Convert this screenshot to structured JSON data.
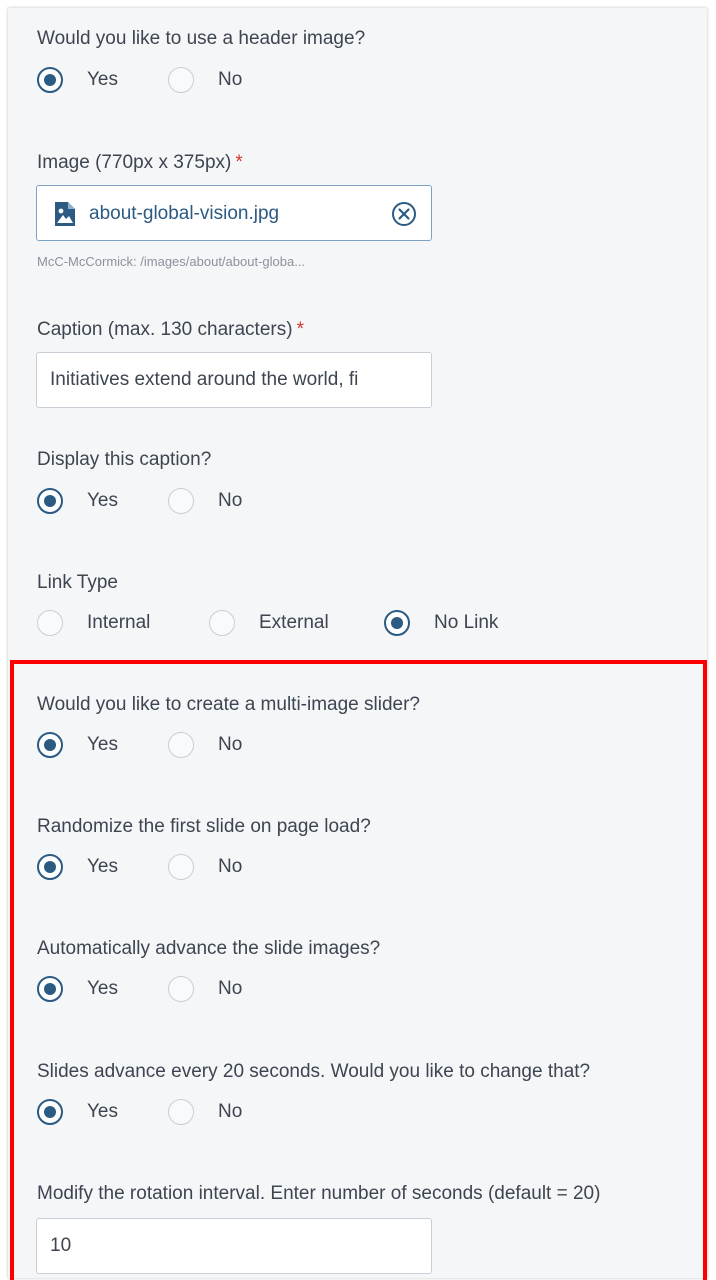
{
  "header_image": {
    "question": "Would you like to use a header image?",
    "options": [
      {
        "label": "Yes",
        "checked": true
      },
      {
        "label": "No",
        "checked": false
      }
    ]
  },
  "image": {
    "label": "Image (770px x 375px)",
    "required_mark": "*",
    "file_name": "about-global-vision.jpg",
    "file_icon": "image-file-icon",
    "remove_icon": "circle-x-icon",
    "path_hint": "McC-McCormick: /images/about/about-globa..."
  },
  "caption": {
    "label": "Caption (max. 130 characters)",
    "required_mark": "*",
    "value": "Initiatives extend around the world, fi"
  },
  "display_caption": {
    "question": "Display this caption?",
    "options": [
      {
        "label": "Yes",
        "checked": true
      },
      {
        "label": "No",
        "checked": false
      }
    ]
  },
  "link_type": {
    "question": "Link Type",
    "options": [
      {
        "label": "Internal",
        "checked": false
      },
      {
        "label": "External",
        "checked": false
      },
      {
        "label": "No Link",
        "checked": true
      }
    ]
  },
  "multi_slider": {
    "question": "Would you like to create a multi-image slider?",
    "options": [
      {
        "label": "Yes",
        "checked": true
      },
      {
        "label": "No",
        "checked": false
      }
    ]
  },
  "randomize": {
    "question": "Randomize the first slide on page load?",
    "options": [
      {
        "label": "Yes",
        "checked": true
      },
      {
        "label": "No",
        "checked": false
      }
    ]
  },
  "auto_advance": {
    "question": "Automatically advance the slide images?",
    "options": [
      {
        "label": "Yes",
        "checked": true
      },
      {
        "label": "No",
        "checked": false
      }
    ]
  },
  "change_interval": {
    "question": "Slides advance every 20 seconds. Would you like to change that?",
    "options": [
      {
        "label": "Yes",
        "checked": true
      },
      {
        "label": "No",
        "checked": false
      }
    ]
  },
  "rotation_interval": {
    "label": "Modify the rotation interval. Enter number of seconds (default = 20)",
    "value": "10"
  },
  "colors": {
    "accent": "#2b5a83",
    "required": "#d9342b",
    "highlight": "#ff0000",
    "panel_bg": "#f5f6f8"
  }
}
